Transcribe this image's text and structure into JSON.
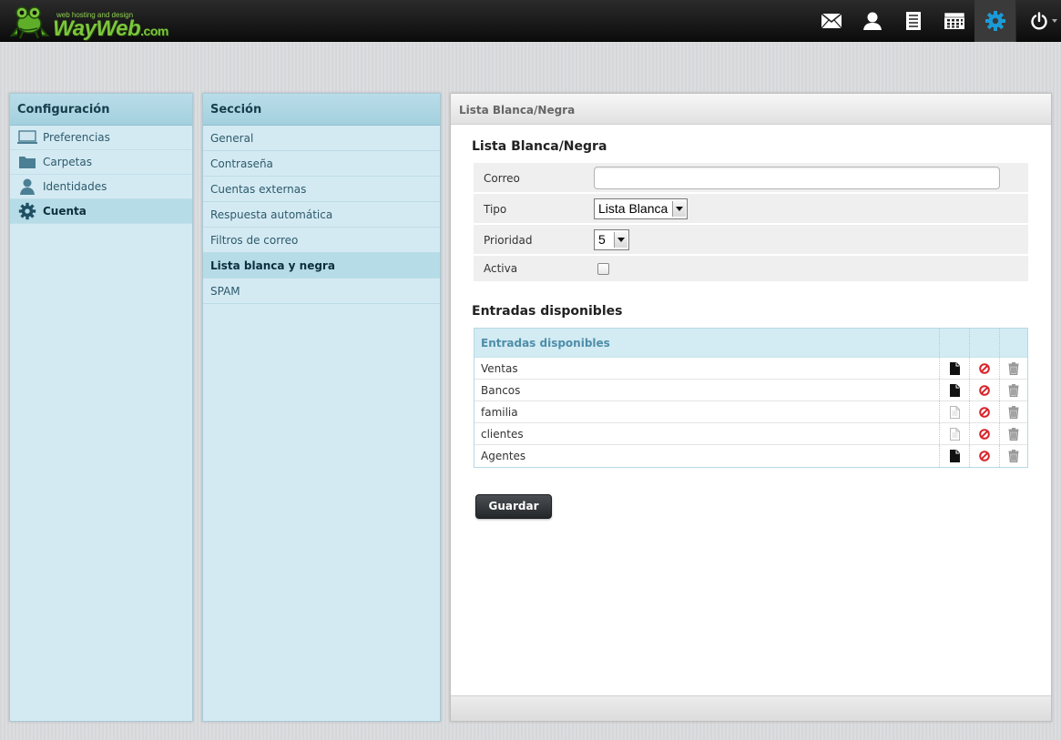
{
  "brand": {
    "tagline": "web hosting and design",
    "name": "WayWeb",
    "suffix": ".com"
  },
  "topnav": {
    "items": [
      {
        "icon": "mail-icon"
      },
      {
        "icon": "contacts-icon"
      },
      {
        "icon": "notes-icon"
      },
      {
        "icon": "calendar-icon"
      },
      {
        "icon": "settings-icon",
        "active": true
      },
      {
        "icon": "power-icon"
      }
    ]
  },
  "config": {
    "title": "Configuración",
    "items": [
      {
        "label": "Preferencias",
        "icon": "monitor-icon"
      },
      {
        "label": "Carpetas",
        "icon": "folder-icon"
      },
      {
        "label": "Identidades",
        "icon": "person-icon"
      },
      {
        "label": "Cuenta",
        "icon": "gear-icon",
        "active": true
      }
    ]
  },
  "section": {
    "title": "Sección",
    "items": [
      {
        "label": "General"
      },
      {
        "label": "Contraseña"
      },
      {
        "label": "Cuentas externas"
      },
      {
        "label": "Respuesta automática"
      },
      {
        "label": "Filtros de correo"
      },
      {
        "label": "Lista blanca y negra",
        "active": true
      },
      {
        "label": "SPAM"
      }
    ]
  },
  "main": {
    "header": "Lista Blanca/Negra",
    "form_title": "Lista Blanca/Negra",
    "form": {
      "correo_label": "Correo",
      "correo_value": "",
      "tipo_label": "Tipo",
      "tipo_value": "Lista Blanca",
      "prioridad_label": "Prioridad",
      "prioridad_value": "5",
      "activa_label": "Activa",
      "activa_checked": false
    },
    "entries_title": "Entradas disponibles",
    "table": {
      "header": "Entradas disponibles",
      "rows": [
        {
          "name": "Ventas",
          "enabled": true
        },
        {
          "name": "Bancos",
          "enabled": true
        },
        {
          "name": "familia",
          "enabled": false
        },
        {
          "name": "clientes",
          "enabled": false
        },
        {
          "name": "Agentes",
          "enabled": true
        }
      ]
    },
    "save_label": "Guardar"
  },
  "colors": {
    "accent": "#1a9bd7",
    "panel_bg": "#d4eaf3",
    "topbar": "#111111",
    "logo_green": "#7cc63b"
  }
}
